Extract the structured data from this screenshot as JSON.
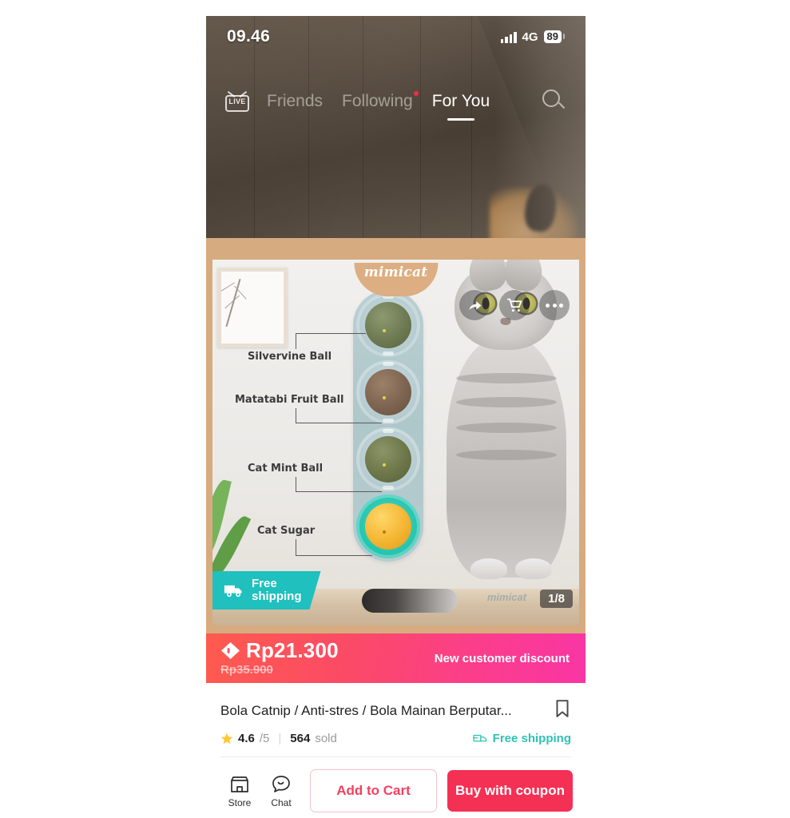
{
  "status_bar": {
    "time": "09.46",
    "network": "4G",
    "battery": "89",
    "signal_icon": "signal-bars-icon",
    "battery_icon": "battery-icon"
  },
  "top_nav": {
    "live_label": "LIVE",
    "live_icon": "live-tv-icon",
    "search_icon": "search-icon",
    "tabs": [
      {
        "label": "Friends",
        "active": false,
        "badge": false
      },
      {
        "label": "Following",
        "active": false,
        "badge": true
      },
      {
        "label": "For You",
        "active": true,
        "badge": false
      }
    ]
  },
  "product_image": {
    "brand": "mimicat",
    "watermark": "mimicat",
    "counter": "1/8",
    "share_icon": "share-arrow-icon",
    "cart_icon": "shopping-cart-icon",
    "more_icon": "more-options-icon",
    "callouts": [
      "Silvervine Ball",
      "Matatabi Fruit Ball",
      "Cat Mint Ball",
      "Cat Sugar"
    ],
    "shipping_ribbon": {
      "line1": "Free",
      "line2": "shipping",
      "icon": "delivery-truck-icon",
      "color": "#1fc0bd"
    }
  },
  "price_bar": {
    "coupon_icon": "coupon-ticket-icon",
    "price_current": "Rp21.300",
    "price_original": "Rp35.900",
    "promo_label": "New customer discount",
    "gradient_from": "#ff5b4e",
    "gradient_to": "#fa35a4"
  },
  "product_info": {
    "title": "Bola Catnip / Anti-stres / Bola Mainan Berputar...",
    "bookmark_icon": "bookmark-icon",
    "star_icon": "star-icon",
    "rating": "4.6",
    "rating_suffix": "/5",
    "sold_count": "564",
    "sold_label": "sold",
    "free_shipping": "Free shipping",
    "free_shipping_icon": "delivery-truck-outline-icon",
    "free_shipping_color": "#2fc2b4"
  },
  "bottom_bar": {
    "store_label": "Store",
    "store_icon": "storefront-icon",
    "chat_label": "Chat",
    "chat_icon": "chat-bubble-icon",
    "add_to_cart": "Add to Cart",
    "buy_with_coupon": "Buy with coupon",
    "cart_color": "#f3415f",
    "buy_color": "#f43054"
  }
}
